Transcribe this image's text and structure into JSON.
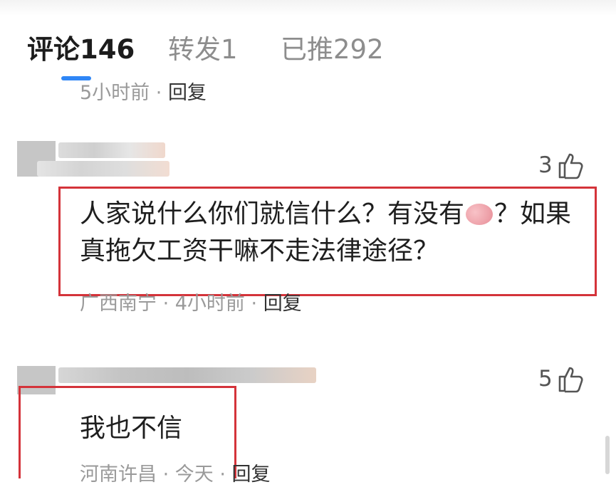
{
  "tabs": [
    {
      "label": "评论146",
      "active": true
    },
    {
      "label": "转发1",
      "active": false
    },
    {
      "label": "已推292",
      "active": false
    }
  ],
  "prev_comment": {
    "time": "5小时前",
    "separator": " · ",
    "reply": "回复"
  },
  "comments": [
    {
      "likes": "3",
      "text_before_emoji": "人家说什么你们就信什么？有没有",
      "emoji": "brain-emoji",
      "text_after_emoji": "？如果真拖欠工资干嘛不走法律途径？",
      "location": "广西南宁",
      "time": "4小时前",
      "separator": " · ",
      "reply": "回复"
    },
    {
      "likes": "5",
      "text": "我也不信",
      "location": "河南许昌",
      "time": "今天",
      "separator": " · ",
      "reply": "回复"
    }
  ],
  "colors": {
    "accent": "#2f86f6",
    "highlight": "#d4333a",
    "meta": "#9a9a9a"
  }
}
